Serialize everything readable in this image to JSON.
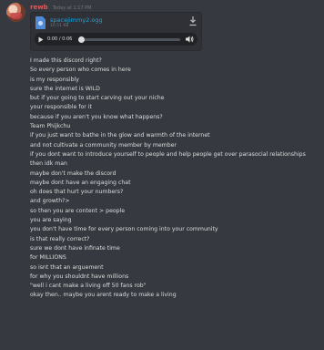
{
  "message": {
    "username": "rewb",
    "timestamp": "Today at 1:17 PM",
    "attachment": {
      "file_name": "spacejimmy2.ogg",
      "file_size": "10.51 KB",
      "player_time": "0:00 / 0:06",
      "progress": 0,
      "icons": [
        "download-icon",
        "play-icon",
        "volume-icon"
      ]
    },
    "lines": [
      "I made this discord right?",
      "So every person who comes in here",
      "is my responsibly",
      "sure the internet is WILD",
      "but if your going to start carving out your niche",
      "your responsible for it",
      "because if you aren't you know what happens?",
      "Team Phijkchu",
      "if you just want to bathe in the glow and warmth of the internet",
      "and not cultivate a community member by member",
      "if you dont want to introduce yourself to people and help people get over parasocial relationships",
      "then idk man",
      "maybe don't make the discord",
      "maybe dont have an engaging chat",
      "oh does that hurt your numbers?",
      "and growth?>",
      "so then you are content > people",
      "you are saying",
      "you don't have time for every person coming into your community",
      "is that really correct?",
      "sure we dont have infinate time",
      "for MILLIONS",
      "so isnt that an arguement",
      "for why you shouldnt have millions",
      "\"well i cant make a living off 50 fans rob\"",
      "okay then.. maybe you arent ready to make a living"
    ]
  },
  "colors": {
    "background": "#36393f",
    "username": "#e0585c",
    "link": "#00b0f4",
    "text": "#dcddde",
    "muted": "#72767d"
  }
}
